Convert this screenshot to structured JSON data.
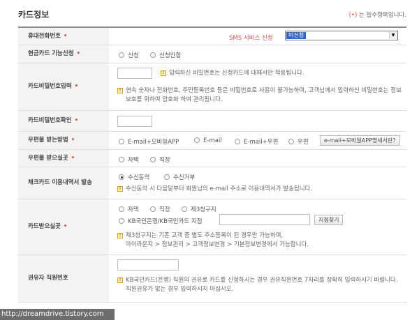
{
  "header": {
    "title": "카드정보",
    "required_note_mark": "(•)",
    "required_note_text": " 는 필수항목입니다."
  },
  "rows": {
    "mobile": {
      "label": "휴대전화번호",
      "sms_label": "SMS 서비스 신청",
      "sms_selected": "미신청"
    },
    "cash_card": {
      "label": "현금카드 기능신청",
      "opt1": "신청",
      "opt2": "신청안함"
    },
    "password": {
      "label": "카드비밀번호입력",
      "note1": "입력하신 비밀번호는 신청카드에 대해서만 적용됩니다.",
      "note2": "연속 숫자나 전화번호, 주민등록번호 등은 비밀번호로 사용이 불가능하며, 고객님께서 입력하신 비밀번호는 정보보호를 위하여 암호화 하여 관리됩니다."
    },
    "password_confirm": {
      "label": "카드비밀번호확인"
    },
    "mail_method": {
      "label": "우편물 받는방법",
      "opt1": "E-mail+모바일APP",
      "opt2": "E-mail",
      "opt3": "E-mail+우편",
      "opt4": "우편",
      "button": "e-mail+모바일APP명세서란?"
    },
    "mail_place": {
      "label": "우편물 받으실곳",
      "opt1": "자택",
      "opt2": "직장"
    },
    "check_card": {
      "label": "체크카드 이용내역서 발송",
      "opt1": "수신동의",
      "opt2": "수신거부",
      "note": "수신동의 시 다음달부터 회원님의 e-mail 주소로 이용내역서가 발송됩니다."
    },
    "card_place": {
      "label": "카드받으실곳",
      "opt1": "자택",
      "opt2": "직장",
      "opt3": "제3청구지",
      "opt4": "KB국민은행/KB국민카드 지점",
      "button": "지점찾기",
      "note1": "제3청구지는 기존 고객 중 별도 주소등록이 된 경우만 가능하며,",
      "note2": "마이라운지 > 정보관리 > 고객정보변경 > 기본정보변경에서 가능합니다."
    },
    "referrer": {
      "label": "권유자 직원번호",
      "note": "KB국민카드(은행) 직원의 권유로 카드를 신청하시는 경우 권유직원번호 7자리를 정확히 입력하시기 바랍니다. 직원권유가 없는 경우 입력하시지 마십시오."
    }
  },
  "watermark": "http://dreamdrive.tistory.com",
  "colors": {
    "required": "#d9534f",
    "label_bg": "#f3f3f3",
    "select_highlight": "#3366cc"
  }
}
